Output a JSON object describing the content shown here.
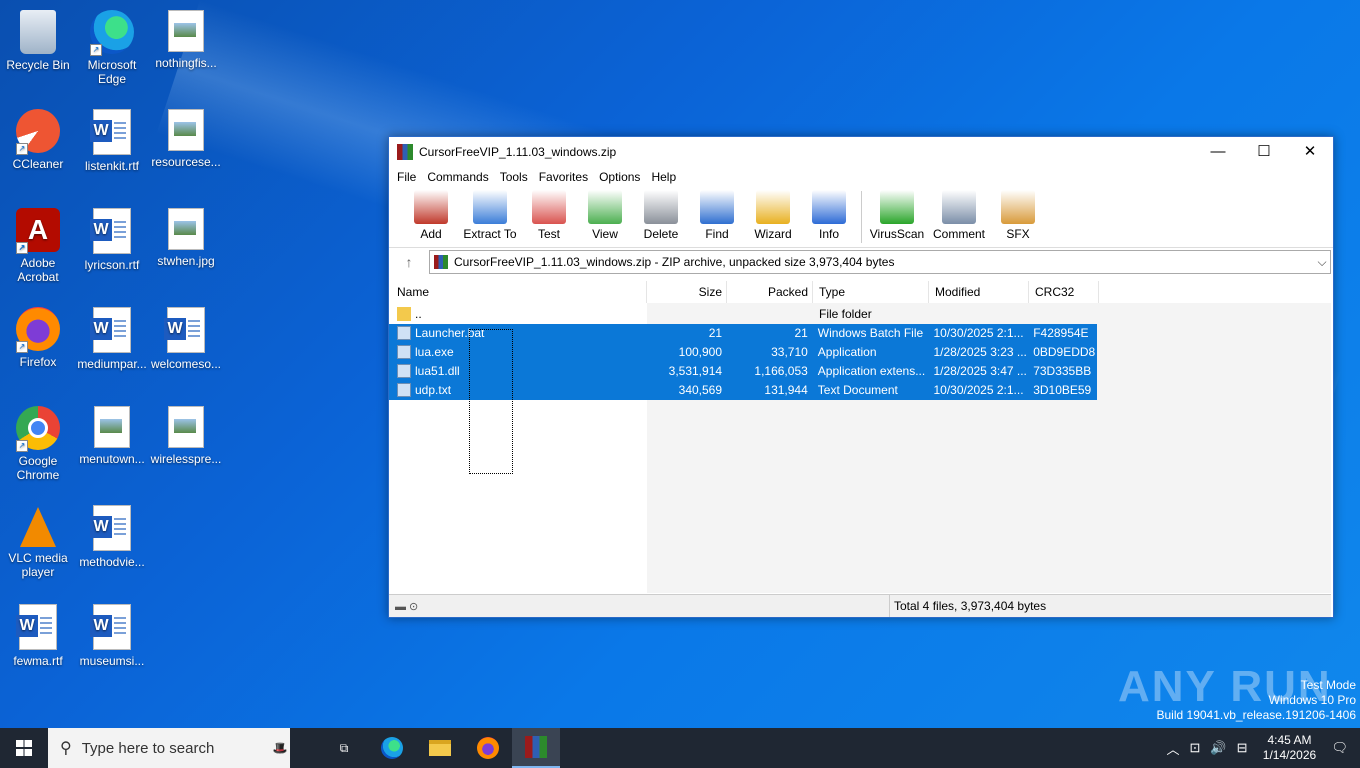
{
  "desktop": {
    "icons": [
      {
        "label": "Recycle Bin"
      },
      {
        "label": "Microsoft Edge"
      },
      {
        "label": "nothingfis..."
      },
      {
        "label": "CCleaner"
      },
      {
        "label": "listenkit.rtf"
      },
      {
        "label": "resourcese..."
      },
      {
        "label": "Adobe Acrobat"
      },
      {
        "label": "lyricson.rtf"
      },
      {
        "label": "stwhen.jpg"
      },
      {
        "label": "Firefox"
      },
      {
        "label": "mediumpar..."
      },
      {
        "label": "welcomeso..."
      },
      {
        "label": "Google Chrome"
      },
      {
        "label": "menutown..."
      },
      {
        "label": "wirelesspre..."
      },
      {
        "label": "VLC media player"
      },
      {
        "label": "methodvie..."
      },
      {
        "label": "fewma.rtf"
      },
      {
        "label": "museumsi..."
      }
    ]
  },
  "window": {
    "title": "CursorFreeVIP_1.11.03_windows.zip",
    "minimize": "—",
    "maximize": "☐",
    "close": "✕",
    "menu": [
      "File",
      "Commands",
      "Tools",
      "Favorites",
      "Options",
      "Help"
    ],
    "toolbar": [
      {
        "label": "Add",
        "color": "#c0392b"
      },
      {
        "label": "Extract To",
        "color": "#3b7dd8"
      },
      {
        "label": "Test",
        "color": "#d9534f"
      },
      {
        "label": "View",
        "color": "#4caf50"
      },
      {
        "label": "Delete",
        "color": "#8a9099"
      },
      {
        "label": "Find",
        "color": "#2f6fd0"
      },
      {
        "label": "Wizard",
        "color": "#e8b020"
      },
      {
        "label": "Info",
        "color": "#2d6bd6"
      },
      {
        "label": "VirusScan",
        "color": "#2aa52a"
      },
      {
        "label": "Comment",
        "color": "#7b8ea8"
      },
      {
        "label": "SFX",
        "color": "#d89a3a"
      }
    ],
    "address": "CursorFreeVIP_1.11.03_windows.zip - ZIP archive, unpacked size 3,973,404 bytes",
    "columns": {
      "name": "Name",
      "size": "Size",
      "packed": "Packed",
      "type": "Type",
      "modified": "Modified",
      "crc": "CRC32"
    },
    "parent_row": {
      "name": "..",
      "type": "File folder"
    },
    "files": [
      {
        "name": "Launcher.bat",
        "size": "21",
        "packed": "21",
        "type": "Windows Batch File",
        "modified": "10/30/2025 2:1...",
        "crc": "F428954E"
      },
      {
        "name": "lua.exe",
        "size": "100,900",
        "packed": "33,710",
        "type": "Application",
        "modified": "1/28/2025 3:23 ...",
        "crc": "0BD9EDD8"
      },
      {
        "name": "lua51.dll",
        "size": "3,531,914",
        "packed": "1,166,053",
        "type": "Application extens...",
        "modified": "1/28/2025 3:47 ...",
        "crc": "73D335BB"
      },
      {
        "name": "udp.txt",
        "size": "340,569",
        "packed": "131,944",
        "type": "Text Document",
        "modified": "10/30/2025 2:1...",
        "crc": "3D10BE59"
      }
    ],
    "status_total": "Total 4 files, 3,973,404 bytes"
  },
  "watermark": {
    "brand": "ANY RUN",
    "line1": "Test Mode",
    "line2": "Windows 10 Pro",
    "line3": "Build 19041.vb_release.191206-1406"
  },
  "taskbar": {
    "search_placeholder": "Type here to search",
    "time": "4:45 AM",
    "date": "1/14/2026"
  }
}
